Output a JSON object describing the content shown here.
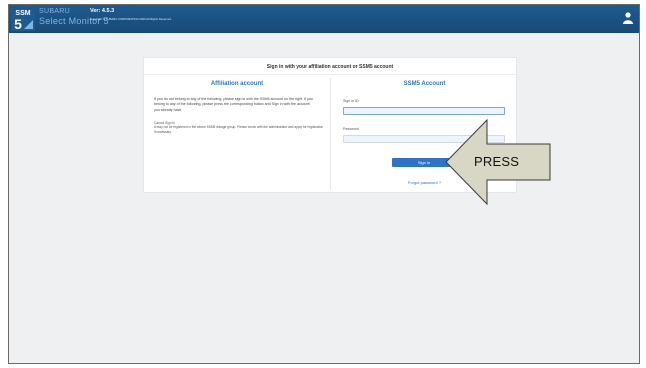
{
  "header": {
    "brand_line1": "SUBARU",
    "brand_line2": "Select Monitor 5",
    "version": "Ver: 4.5.3",
    "copyright": "Copyright ® SUBARU CORPORATION 2020 All Rights Reserved.",
    "logo_text_top": "SSM",
    "logo_text_num": "5"
  },
  "card": {
    "title": "Sign in with your affiliation account or SSM5 account",
    "affiliation": {
      "heading": "Affiliation account",
      "description": "If you do not belong to any of the following, please sign in with the SSM5 account on the right. If you belong to any of the following, please press the corresponding button and Sign in with the account you already have.",
      "cannot_title": "Cannot Sign in",
      "cannot_text": "It may not be registered in the above SSM5 linkage group. Please check with the administrator and apply for registration if necessary."
    },
    "ssm5": {
      "heading": "SSM5 Account",
      "signin_id_label": "Sign in ID",
      "signin_id_value": "",
      "password_label": "Password",
      "password_value": "",
      "signin_button": "Sign in",
      "forgot_link": "Forgot password ?"
    }
  },
  "annotation": {
    "callout_text": "PRESS"
  },
  "colors": {
    "header_bg": "#1f5a8f",
    "accent": "#2f74c4",
    "page_bg": "#eef0f2",
    "callout_fill": "#d8d6c4"
  },
  "icons": {
    "user": "user-icon",
    "logo": "ssm5-logo"
  }
}
